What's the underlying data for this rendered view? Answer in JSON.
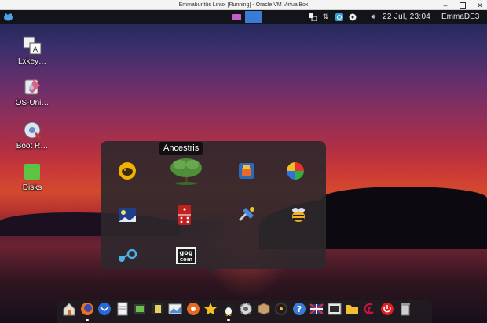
{
  "host_window": {
    "title": "Emmabuntüs Linux [Running] - Oracle VM VirtualBox"
  },
  "top_panel": {
    "clock": "22 Jul, 23:04",
    "username": "EmmaDE3",
    "tray_icons": [
      "network-icon",
      "transfer-icon",
      "update-icon",
      "media-icon",
      "volume-icon"
    ]
  },
  "desktop_icons": [
    {
      "label": "Lxkey…",
      "icon": "keyboard-layout-icon"
    },
    {
      "label": "OS-Uni…",
      "icon": "os-uninstaller-icon"
    },
    {
      "label": "Boot R…",
      "icon": "boot-repair-icon"
    },
    {
      "label": "Disks",
      "icon": "disks-icon"
    }
  ],
  "folder": {
    "tooltip": "Ancestris",
    "apps": [
      "piggy-bank-icon",
      "ancestris-tree-icon",
      "shopping-app-icon",
      "pinwheel-icon",
      "night-scene-icon",
      "domino-icon",
      "tools-icon",
      "bee-icon",
      "steam-icon",
      "gog-icon"
    ],
    "gog_text": "gog\ncom"
  },
  "dock": {
    "items": [
      "home-folder-icon",
      "firefox-icon",
      "thunderbird-icon",
      "text-editor-icon",
      "video-editor-icon",
      "film-icon",
      "image-viewer-icon",
      "media-player-icon",
      "favorites-star-icon",
      "linux-tux-icon",
      "settings-gear-icon",
      "package-icon",
      "accessibility-icon",
      "help-icon",
      "flag-icon",
      "terminal-icon",
      "folder-icon",
      "debian-swirl-icon",
      "power-icon",
      "trash-icon"
    ]
  },
  "colors": {
    "active_task": "#3a7bd5",
    "panel": "#121216",
    "popup": "#2e282c"
  }
}
